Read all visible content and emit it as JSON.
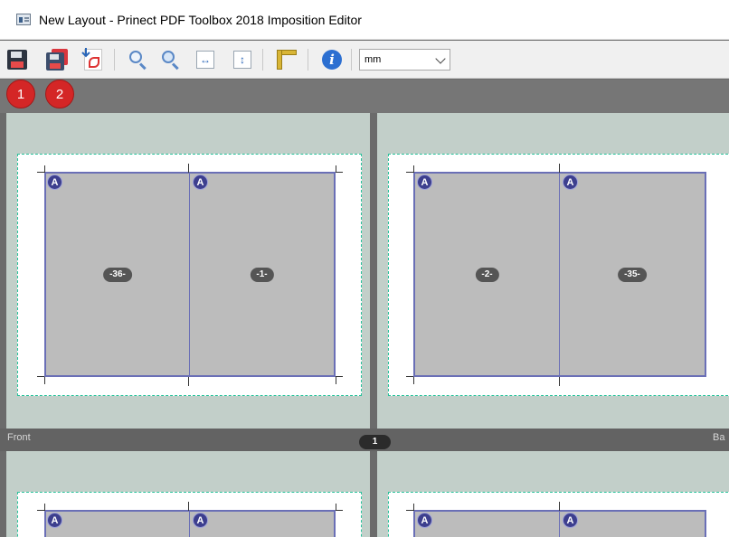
{
  "window": {
    "title": "New Layout - Prinect PDF Toolbox 2018 Imposition Editor"
  },
  "toolbar": {
    "buttons": [
      {
        "name": "save-icon"
      },
      {
        "name": "save-as-icon"
      },
      {
        "name": "export-pdf-icon"
      },
      {
        "name": "zoom-in-icon"
      },
      {
        "name": "zoom-out-icon"
      },
      {
        "name": "fit-width-icon"
      },
      {
        "name": "fit-height-icon"
      },
      {
        "name": "ruler-icon"
      },
      {
        "name": "info-icon"
      }
    ],
    "unit_select": {
      "value": "mm"
    }
  },
  "annotations": {
    "step1": "1",
    "step2": "2"
  },
  "layout": {
    "front_label": "Front",
    "back_label": "Ba",
    "sheet_number": "1",
    "signature_letter": "A",
    "sheets": [
      {
        "pages": [
          "-36-",
          "-1-"
        ]
      },
      {
        "pages": [
          "-2-",
          "-35-"
        ]
      },
      {
        "pages": [
          "",
          ""
        ]
      },
      {
        "pages": [
          "",
          ""
        ]
      }
    ]
  },
  "colors": {
    "sheet_bg": "#c2cfc9",
    "page_fill": "#bcbcbc",
    "trim_frame": "#6a6fb6",
    "bleed_border": "#27c29a",
    "step_badge": "#d42626"
  }
}
